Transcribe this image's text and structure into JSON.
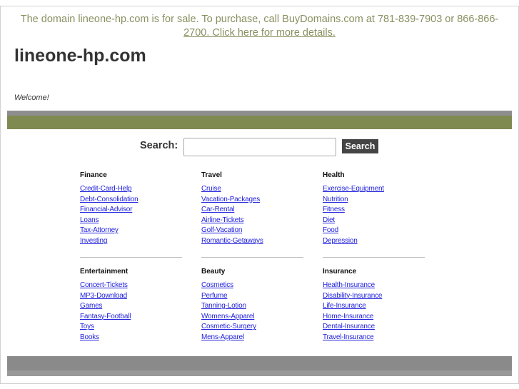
{
  "banner": {
    "text": "The domain lineone-hp.com is for sale. To purchase, call BuyDomains.com at 781-839-7903 or 866-866-",
    "link": "2700. Click here for more details."
  },
  "site_title": "lineone-hp.com",
  "welcome": "Welcome!",
  "search": {
    "label": "Search:",
    "value": "",
    "button": "Search"
  },
  "colors": {
    "accent_green": "#7e8a50",
    "banner_text": "#8a9060",
    "link": "#2222dd"
  },
  "categories": [
    {
      "title": "Finance",
      "links": [
        "Credit-Card-Help",
        "Debt-Consolidation",
        "Financial-Advisor",
        "Loans",
        "Tax-Attorney",
        "Investing"
      ]
    },
    {
      "title": "Travel",
      "links": [
        "Cruise",
        "Vacation-Packages",
        "Car-Rental",
        "Airline-Tickets",
        "Golf-Vacation",
        "Romantic-Getaways"
      ]
    },
    {
      "title": "Health",
      "links": [
        "Exercise-Equipment",
        "Nutrition",
        "Fitness",
        "Diet",
        "Food",
        "Depression"
      ]
    },
    {
      "title": "Entertainment",
      "links": [
        "Concert-Tickets",
        "MP3-Download",
        "Games",
        "Fantasy-Football",
        "Toys",
        "Books"
      ]
    },
    {
      "title": "Beauty",
      "links": [
        "Cosmetics",
        "Perfume",
        "Tanning-Lotion",
        "Womens-Apparel",
        "Cosmetic-Surgery",
        "Mens-Apparel"
      ]
    },
    {
      "title": "Insurance",
      "links": [
        "Health-Insurance",
        "Disability-Insurance",
        "Life-Insurance",
        "Home-Insurance",
        "Dental-Insurance",
        "Travel-Insurance"
      ]
    }
  ]
}
